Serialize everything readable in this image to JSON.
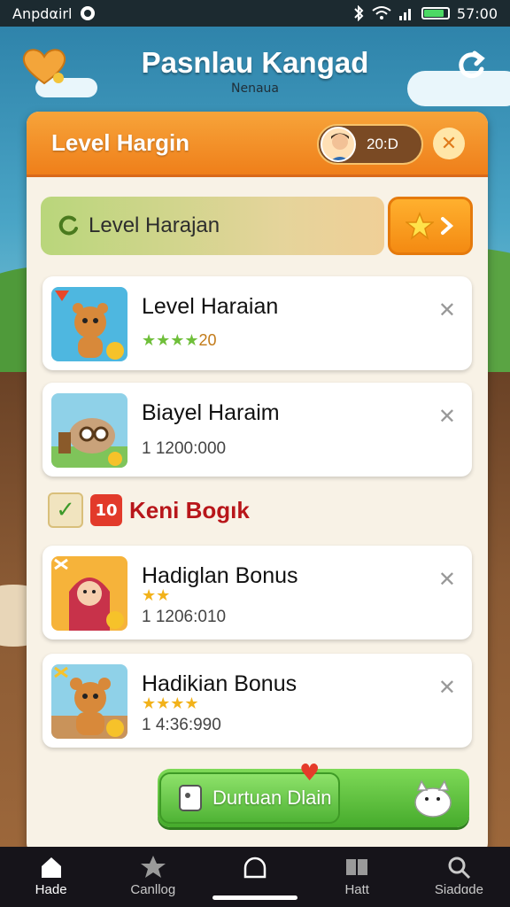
{
  "status_bar": {
    "carrier": "Anpdαirl",
    "time": "57:00"
  },
  "header": {
    "title": "Pasnlau Kangad",
    "subtitle": "Nenaua"
  },
  "panel": {
    "title": "Level Hargin",
    "score": "20:D",
    "close_label": "✕"
  },
  "level_bar": {
    "label": "Level Harajan"
  },
  "cards": [
    {
      "title": "Level Haraian",
      "stars": "★★★★",
      "value": "20",
      "x": "✕"
    },
    {
      "title": "Biayel Haraim",
      "value": "1 1200:000",
      "x": "✕"
    },
    {
      "title": "Hadiglan Bonus",
      "stars": "★★",
      "value": "1 1206:010",
      "x": "✕"
    },
    {
      "title": "Hadikian Bonus",
      "stars": "★★★★",
      "value": "1 4:36:990",
      "x": "✕"
    }
  ],
  "section": {
    "title": "Keni Bogık",
    "gift_glyph": "10"
  },
  "claim_button": {
    "label": "Durtuan Dlain"
  },
  "nav": [
    {
      "label": "Hade",
      "icon": "home-icon"
    },
    {
      "label": "Canllog",
      "icon": "star-icon"
    },
    {
      "label": "",
      "icon": "circle-icon"
    },
    {
      "label": "Hatt",
      "icon": "book-icon"
    },
    {
      "label": "Siadɑde",
      "icon": "search-icon"
    }
  ],
  "colors": {
    "panel_header": "#ef7f1a",
    "accent_green": "#46ab2c",
    "section_red": "#b8161a"
  }
}
